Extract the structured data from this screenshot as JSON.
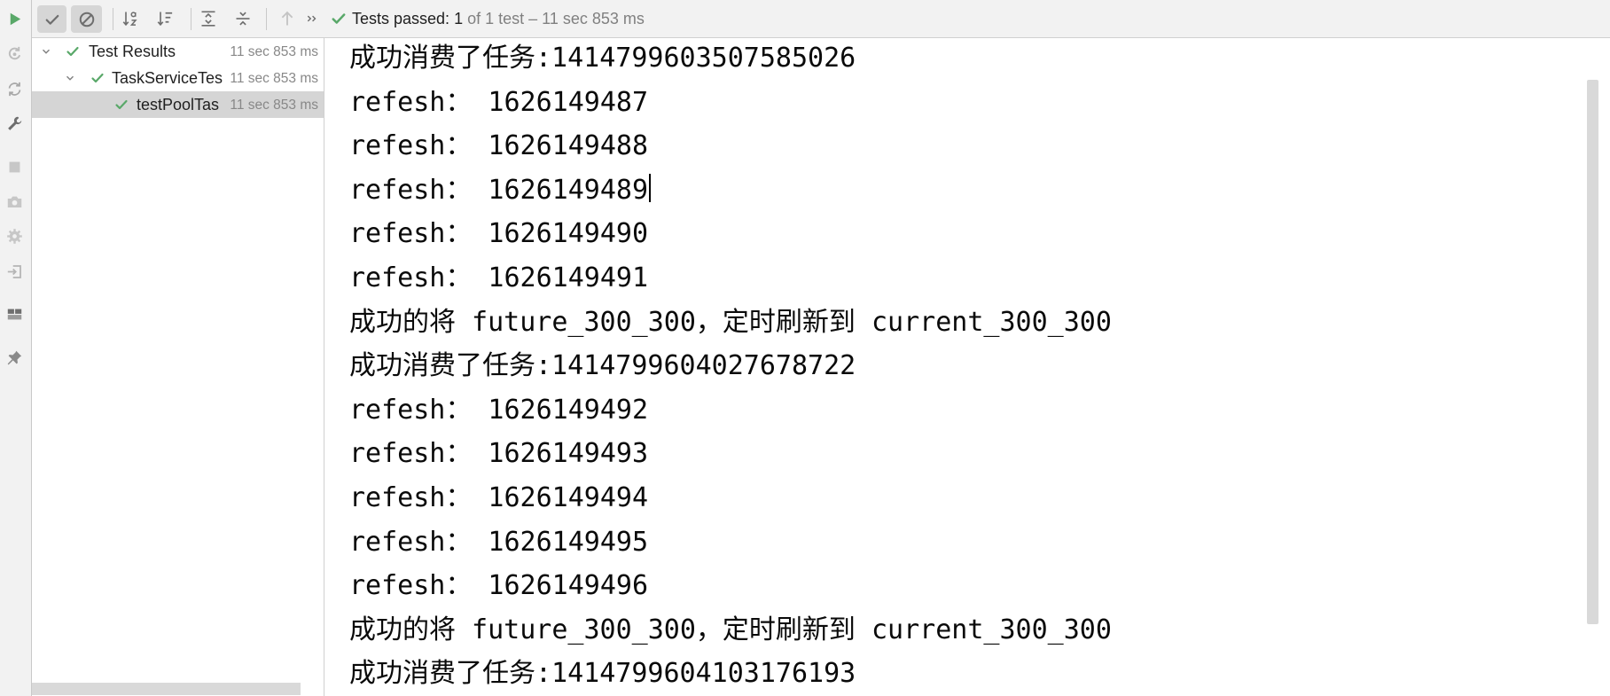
{
  "colors": {
    "toolbar_bg": "#f2f2f2",
    "panel_bg": "#ffffff",
    "selection_bg": "#d5d5d5",
    "passed_green": "#59a869",
    "console_text": "#0a0a0a",
    "muted_text": "#808080"
  },
  "left_toolbar": {
    "icons": [
      "run-icon",
      "rerun-failed-icon",
      "toggle-auto-test-icon",
      "wrench-icon",
      "stop-icon",
      "camera-icon",
      "gear-icon",
      "import-icon",
      "layout-icon",
      "pin-icon"
    ]
  },
  "test_toolbar": {
    "icons": [
      "check-icon",
      "circle-slash-icon",
      "sort-alphabetically-icon",
      "sort-by-duration-icon",
      "expand-all-icon",
      "collapse-all-icon",
      "arrow-up-icon",
      "double-chevron-right-icon"
    ],
    "show_passed_pressed": true,
    "show_ignored_pressed": true
  },
  "status": {
    "icon": "passed-check-icon",
    "label": "Tests passed:",
    "count": "1",
    "detail": "of 1 test – 11 sec 853 ms"
  },
  "tree": {
    "items": [
      {
        "label": "Test Results",
        "duration": "11 sec 853 ms",
        "status": "passed",
        "expanded": true,
        "selected": false
      },
      {
        "label": "TaskServiceTes",
        "duration": "11 sec 853 ms",
        "status": "passed",
        "expanded": true,
        "selected": false
      },
      {
        "label": "testPoolTas",
        "duration": "11 sec 853 ms",
        "status": "passed",
        "selected": true
      }
    ]
  },
  "console": {
    "lines": [
      "成功消费了任务:1414799603507585026",
      "refesh： 1626149487",
      "refesh： 1626149488",
      "refesh： 1626149489",
      "refesh： 1626149490",
      "refesh： 1626149491",
      "成功的将 future_300_300，定时刷新到 current_300_300",
      "成功消费了任务:1414799604027678722",
      "refesh： 1626149492",
      "refesh： 1626149493",
      "refesh： 1626149494",
      "refesh： 1626149495",
      "refesh： 1626149496",
      "成功的将 future_300_300，定时刷新到 current_300_300",
      "成功消费了任务:1414799604103176193"
    ]
  }
}
